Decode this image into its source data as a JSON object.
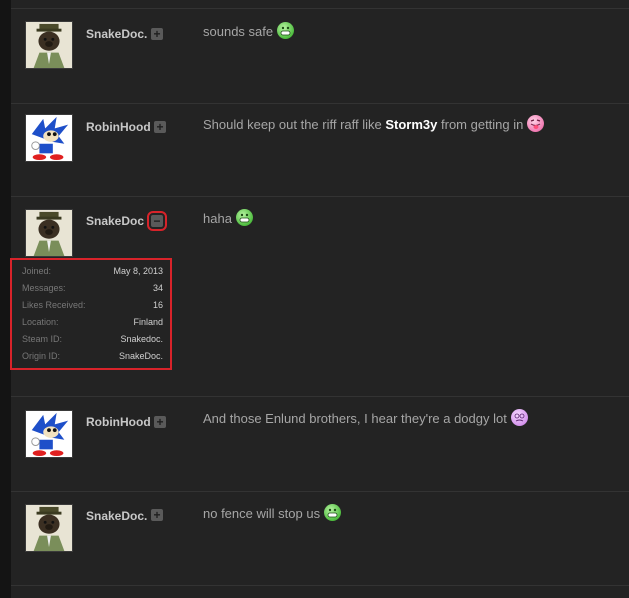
{
  "posts": [
    {
      "username": "SnakeDoc.",
      "message": "sounds safe",
      "emoji": "grin-emoji",
      "avatar": "otter-avatar",
      "toggle": "+"
    },
    {
      "username": "RobinHood",
      "message_before": "Should keep out the riff raff like ",
      "mention": "Storm3y",
      "message_after": " from getting in",
      "emoji": "tongue-emoji",
      "avatar": "hedgehog-avatar",
      "toggle": "+"
    },
    {
      "username": "SnakeDoc",
      "message": "haha",
      "emoji": "grin-emoji",
      "avatar": "otter-avatar",
      "toggle": "−",
      "userinfo": [
        {
          "label": "Joined:",
          "value": "May 8, 2013"
        },
        {
          "label": "Messages:",
          "value": "34"
        },
        {
          "label": "Likes Received:",
          "value": "16"
        },
        {
          "label": "Location:",
          "value": "Finland"
        },
        {
          "label": "Steam ID:",
          "value": "Snakedoc."
        },
        {
          "label": "Origin ID:",
          "value": "SnakeDoc."
        }
      ]
    },
    {
      "username": "RobinHood",
      "message": "And those Enlund brothers, I hear they're a dodgy lot",
      "emoji": "dizzy-emoji",
      "avatar": "hedgehog-avatar",
      "toggle": "+"
    },
    {
      "username": "SnakeDoc.",
      "message": "no fence will stop us",
      "emoji": "grin-emoji",
      "avatar": "otter-avatar",
      "toggle": "+"
    }
  ],
  "colors": {
    "background": "#232323",
    "highlight": "#d8232a",
    "username": "#c8c8c8",
    "message": "#a6a6a6"
  }
}
